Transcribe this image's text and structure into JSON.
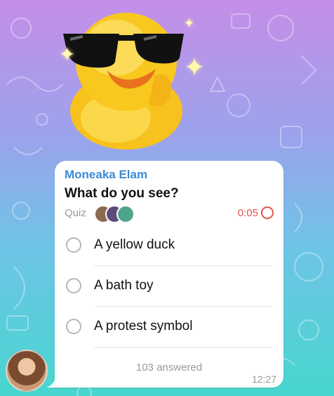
{
  "message": {
    "sender": "Moneaka Elam",
    "question": "What do you see?",
    "quiz_label": "Quiz",
    "timer": "0:05",
    "options": [
      {
        "label": "A yellow duck"
      },
      {
        "label": "A bath toy"
      },
      {
        "label": "A protest symbol"
      }
    ],
    "answered": "103 answered",
    "time": "12:27"
  },
  "colors": {
    "sender": "#3b8bd6",
    "timer": "#e0554c",
    "bubble": "#ffffff"
  },
  "icons": {
    "sticker": "duck-with-sunglasses-sticker",
    "timer": "circle-timer-icon",
    "radio": "radio-circle-icon"
  }
}
